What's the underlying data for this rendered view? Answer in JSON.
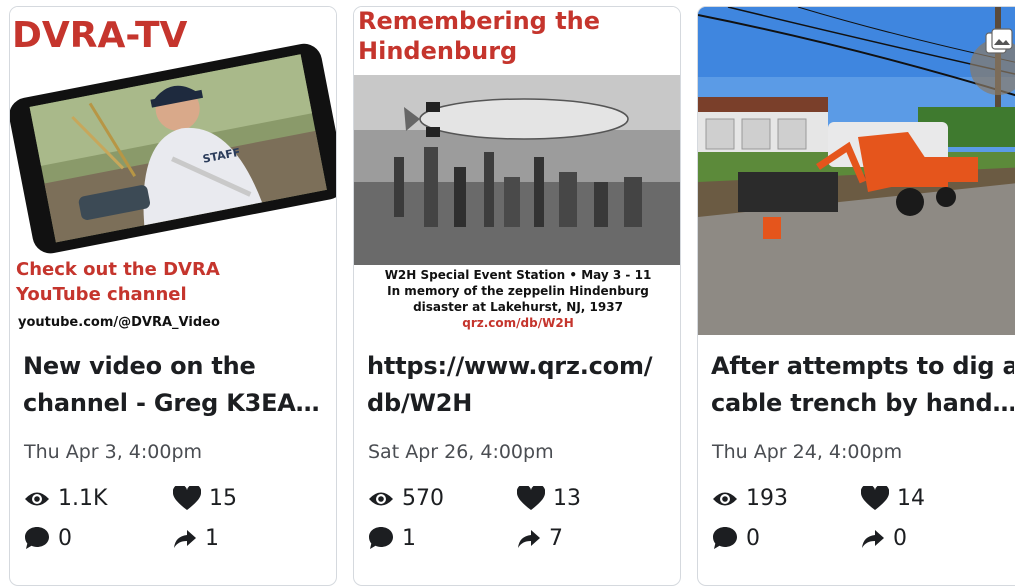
{
  "cards": [
    {
      "image": {
        "banner_title": "DVRA-TV",
        "callout_line1": "Check out the DVRA",
        "callout_line2": "YouTube channel",
        "url": "youtube.com/@DVRA_Video",
        "cap_text": "STAFF"
      },
      "headline_lines": [
        "New video on the",
        "channel - Greg K3EA…"
      ],
      "date": "Thu Apr 3, 4:00pm",
      "views": "1.1K",
      "likes": "15",
      "comments": "0",
      "shares": "1"
    },
    {
      "image": {
        "title_line1": "Remembering the",
        "title_line2": "Hindenburg",
        "caption_line1": "W2H Special Event Station • May 3 - 11",
        "caption_line2": "In memory of the zeppelin Hindenburg",
        "caption_line3": "disaster at Lakehurst, NJ, 1937",
        "caption_url": "qrz.com/db/W2H"
      },
      "headline_lines": [
        "https://www.qrz.com/",
        "db/W2H"
      ],
      "date": "Sat Apr 26, 4:00pm",
      "views": "570",
      "likes": "13",
      "comments": "1",
      "shares": "7"
    },
    {
      "image": {},
      "headline_lines": [
        "After attempts to dig a",
        "cable trench by hand…"
      ],
      "date": "Thu Apr 24, 4:00pm",
      "views": "193",
      "likes": "14",
      "comments": "0",
      "shares": "0"
    }
  ],
  "icons": {
    "views": "eye-icon",
    "likes": "heart-icon",
    "comments": "comment-bubble-icon",
    "shares": "share-arrow-icon",
    "corner": "gallery-icon"
  },
  "colors": {
    "brand_red": "#c5352d",
    "text": "#1c1e21",
    "muted": "#4a4d52",
    "border": "#d5d9de"
  }
}
